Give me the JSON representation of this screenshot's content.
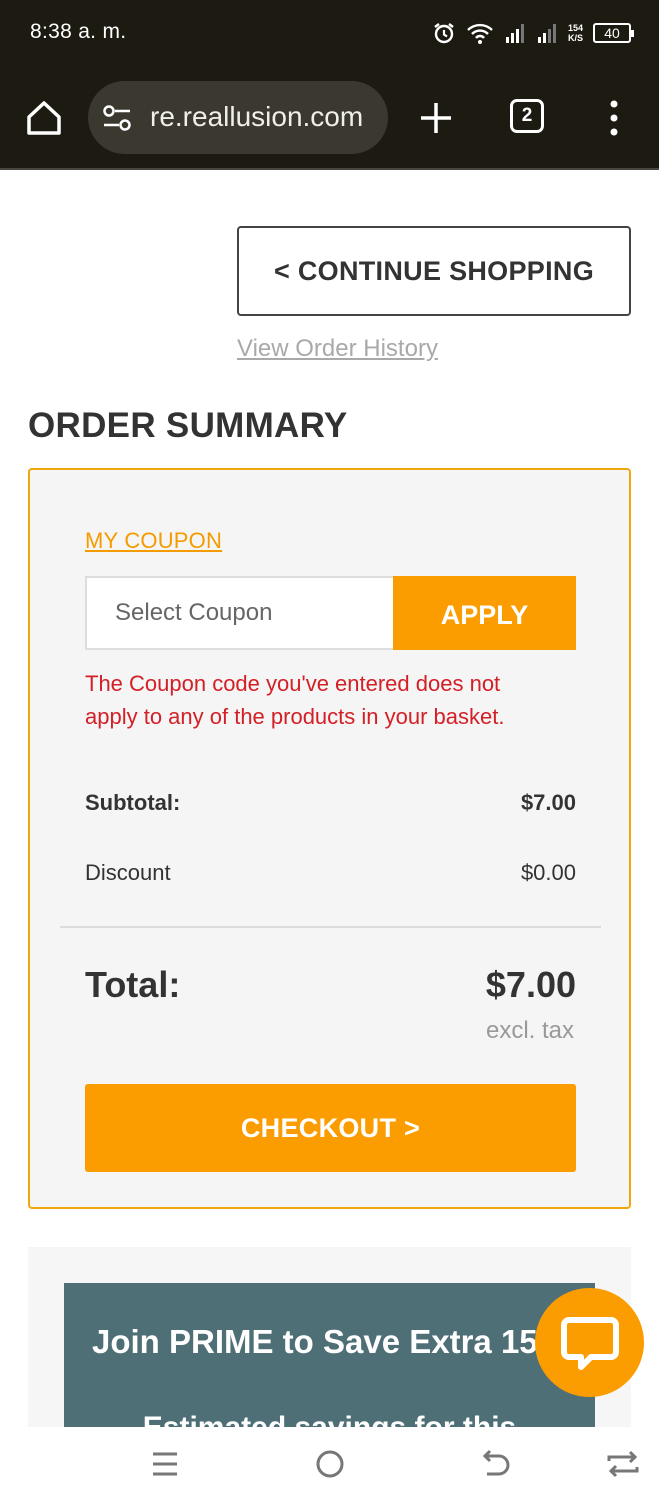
{
  "status_bar": {
    "time": "8:38 a. m.",
    "network_speed_value": "154",
    "network_speed_unit": "K/S",
    "battery_level": "40",
    "icons": [
      "alarm-icon",
      "wifi-icon",
      "signal-icon",
      "signal-icon",
      "battery-icon"
    ]
  },
  "browser": {
    "url": "re.reallusion.com",
    "tab_count": "2",
    "icons": [
      "home-icon",
      "tune-icon",
      "plus-icon",
      "tabs-icon",
      "more-vert-icon"
    ]
  },
  "page": {
    "continue_shopping_label": "< CONTINUE SHOPPING",
    "view_order_history_label": "View Order History",
    "order_summary_title": "ORDER SUMMARY"
  },
  "coupon": {
    "link_label": "MY COUPON",
    "input_placeholder": "Select Coupon",
    "apply_label": "APPLY",
    "error_message": "The Coupon code you've entered does not apply to any of the products in your basket."
  },
  "totals": {
    "subtotal_label": "Subtotal:",
    "subtotal_value": "$7.00",
    "discount_label": "Discount",
    "discount_value": "$0.00",
    "total_label": "Total:",
    "total_value": "$7.00",
    "tax_note": "excl. tax"
  },
  "checkout_label": "CHECKOUT >",
  "promo": {
    "title": "Join PRIME to Save Extra 15%",
    "subtitle": "Estimated savings for this"
  },
  "chat_icon": "chat-icon",
  "nav_bar": {
    "icons": [
      "recent-apps-icon",
      "home-circle-icon",
      "back-icon",
      "rotate-icon"
    ]
  },
  "colors": {
    "accent_orange": "#fb9d00",
    "error_red": "#d32027",
    "promo_teal": "#4f6f77",
    "browser_dark": "#1d1a12"
  }
}
